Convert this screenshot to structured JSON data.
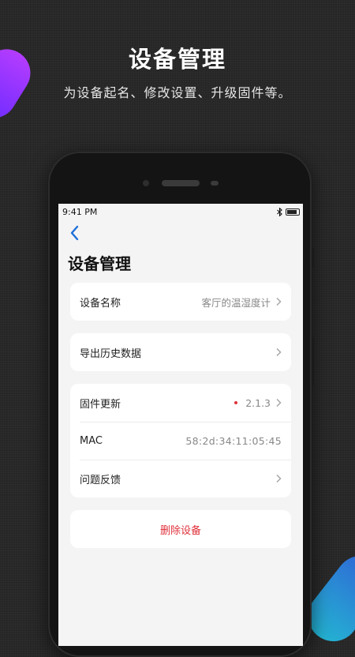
{
  "promo": {
    "title": "设备管理",
    "subtitle": "为设备起名、修改设置、升级固件等。"
  },
  "status_bar": {
    "time": "9:41 PM",
    "icons": [
      "bluetooth-icon",
      "battery-icon"
    ]
  },
  "screen": {
    "back_icon": "chevron-left-icon",
    "title": "设备管理",
    "cards": {
      "name": {
        "label": "设备名称",
        "value": "客厅的温湿度计"
      },
      "export": {
        "label": "导出历史数据"
      },
      "firmware": {
        "label": "固件更新",
        "value": "2.1.3",
        "has_update_dot": true
      },
      "mac": {
        "label": "MAC",
        "value": "58:2d:34:11:05:45"
      },
      "feedback": {
        "label": "问题反馈"
      },
      "delete": {
        "label": "删除设备"
      }
    }
  },
  "colors": {
    "accent": "#1e6fd9",
    "danger": "#e0303a",
    "screen_bg": "#f4f4f4"
  }
}
